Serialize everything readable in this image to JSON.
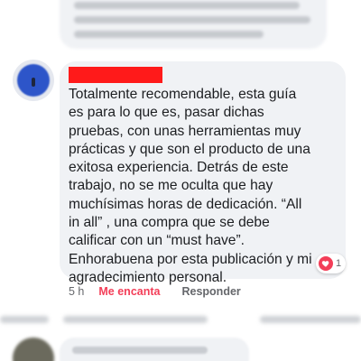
{
  "comment": {
    "lines": [
      "Totalmente recomendable, esta guía",
      "es para lo que es, pasar dichas",
      "pruebas, con unas herramientas muy",
      "prácticas y que son el producto de una",
      "exitosa experiencia. Detrás de este",
      "trabajo, no se me oculta que hay",
      "muchísimas horas de dedicación.  “All",
      "in all” , una compra que se debe",
      "calificar con un “must have”.",
      "Enhorabuena por esta publicación y mi",
      "agradecimiento personal."
    ],
    "reaction": {
      "icon": "heart-icon",
      "count": "1",
      "color": "#f33e58"
    }
  },
  "actions": {
    "time": "5 h",
    "love": "Me encanta",
    "reply": "Responder"
  },
  "colors": {
    "bubble": "#f0f2f5",
    "text": "#1c1e21",
    "muted": "#65676b",
    "love": "#f33e58",
    "redaction": "#ff1a1a"
  }
}
